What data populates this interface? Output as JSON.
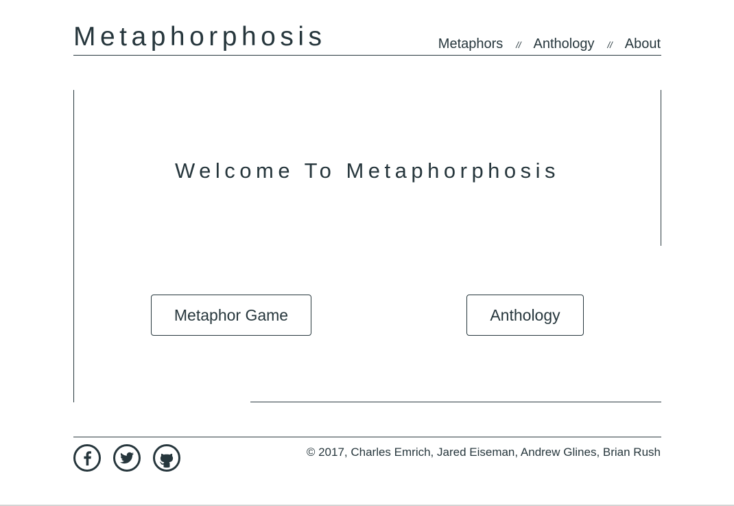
{
  "header": {
    "title": "Metaphorphosis",
    "nav": {
      "metaphors": "Metaphors",
      "anthology": "Anthology",
      "about": "About",
      "separator": "//"
    }
  },
  "main": {
    "welcome": "Welcome To Metaphorphosis",
    "buttons": {
      "game": "Metaphor Game",
      "anthology": "Anthology"
    }
  },
  "footer": {
    "copyright": "© 2017, Charles Emrich, Jared Eiseman, Andrew Glines, Brian Rush",
    "social_icons": [
      "facebook-icon",
      "twitter-icon",
      "github-icon"
    ]
  },
  "colors": {
    "text": "#26363c",
    "background": "#ffffff"
  }
}
